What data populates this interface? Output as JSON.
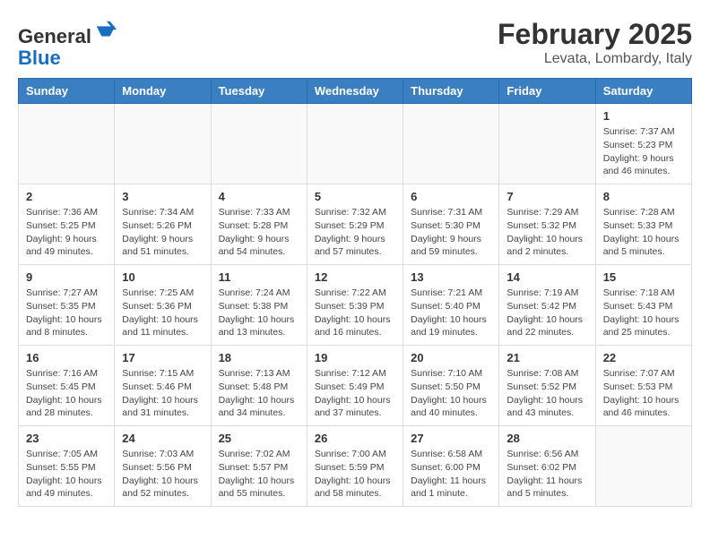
{
  "header": {
    "logo_general": "General",
    "logo_blue": "Blue",
    "month_year": "February 2025",
    "location": "Levata, Lombardy, Italy"
  },
  "weekdays": [
    "Sunday",
    "Monday",
    "Tuesday",
    "Wednesday",
    "Thursday",
    "Friday",
    "Saturday"
  ],
  "weeks": [
    [
      {
        "day": "",
        "info": ""
      },
      {
        "day": "",
        "info": ""
      },
      {
        "day": "",
        "info": ""
      },
      {
        "day": "",
        "info": ""
      },
      {
        "day": "",
        "info": ""
      },
      {
        "day": "",
        "info": ""
      },
      {
        "day": "1",
        "info": "Sunrise: 7:37 AM\nSunset: 5:23 PM\nDaylight: 9 hours and 46 minutes."
      }
    ],
    [
      {
        "day": "2",
        "info": "Sunrise: 7:36 AM\nSunset: 5:25 PM\nDaylight: 9 hours and 49 minutes."
      },
      {
        "day": "3",
        "info": "Sunrise: 7:34 AM\nSunset: 5:26 PM\nDaylight: 9 hours and 51 minutes."
      },
      {
        "day": "4",
        "info": "Sunrise: 7:33 AM\nSunset: 5:28 PM\nDaylight: 9 hours and 54 minutes."
      },
      {
        "day": "5",
        "info": "Sunrise: 7:32 AM\nSunset: 5:29 PM\nDaylight: 9 hours and 57 minutes."
      },
      {
        "day": "6",
        "info": "Sunrise: 7:31 AM\nSunset: 5:30 PM\nDaylight: 9 hours and 59 minutes."
      },
      {
        "day": "7",
        "info": "Sunrise: 7:29 AM\nSunset: 5:32 PM\nDaylight: 10 hours and 2 minutes."
      },
      {
        "day": "8",
        "info": "Sunrise: 7:28 AM\nSunset: 5:33 PM\nDaylight: 10 hours and 5 minutes."
      }
    ],
    [
      {
        "day": "9",
        "info": "Sunrise: 7:27 AM\nSunset: 5:35 PM\nDaylight: 10 hours and 8 minutes."
      },
      {
        "day": "10",
        "info": "Sunrise: 7:25 AM\nSunset: 5:36 PM\nDaylight: 10 hours and 11 minutes."
      },
      {
        "day": "11",
        "info": "Sunrise: 7:24 AM\nSunset: 5:38 PM\nDaylight: 10 hours and 13 minutes."
      },
      {
        "day": "12",
        "info": "Sunrise: 7:22 AM\nSunset: 5:39 PM\nDaylight: 10 hours and 16 minutes."
      },
      {
        "day": "13",
        "info": "Sunrise: 7:21 AM\nSunset: 5:40 PM\nDaylight: 10 hours and 19 minutes."
      },
      {
        "day": "14",
        "info": "Sunrise: 7:19 AM\nSunset: 5:42 PM\nDaylight: 10 hours and 22 minutes."
      },
      {
        "day": "15",
        "info": "Sunrise: 7:18 AM\nSunset: 5:43 PM\nDaylight: 10 hours and 25 minutes."
      }
    ],
    [
      {
        "day": "16",
        "info": "Sunrise: 7:16 AM\nSunset: 5:45 PM\nDaylight: 10 hours and 28 minutes."
      },
      {
        "day": "17",
        "info": "Sunrise: 7:15 AM\nSunset: 5:46 PM\nDaylight: 10 hours and 31 minutes."
      },
      {
        "day": "18",
        "info": "Sunrise: 7:13 AM\nSunset: 5:48 PM\nDaylight: 10 hours and 34 minutes."
      },
      {
        "day": "19",
        "info": "Sunrise: 7:12 AM\nSunset: 5:49 PM\nDaylight: 10 hours and 37 minutes."
      },
      {
        "day": "20",
        "info": "Sunrise: 7:10 AM\nSunset: 5:50 PM\nDaylight: 10 hours and 40 minutes."
      },
      {
        "day": "21",
        "info": "Sunrise: 7:08 AM\nSunset: 5:52 PM\nDaylight: 10 hours and 43 minutes."
      },
      {
        "day": "22",
        "info": "Sunrise: 7:07 AM\nSunset: 5:53 PM\nDaylight: 10 hours and 46 minutes."
      }
    ],
    [
      {
        "day": "23",
        "info": "Sunrise: 7:05 AM\nSunset: 5:55 PM\nDaylight: 10 hours and 49 minutes."
      },
      {
        "day": "24",
        "info": "Sunrise: 7:03 AM\nSunset: 5:56 PM\nDaylight: 10 hours and 52 minutes."
      },
      {
        "day": "25",
        "info": "Sunrise: 7:02 AM\nSunset: 5:57 PM\nDaylight: 10 hours and 55 minutes."
      },
      {
        "day": "26",
        "info": "Sunrise: 7:00 AM\nSunset: 5:59 PM\nDaylight: 10 hours and 58 minutes."
      },
      {
        "day": "27",
        "info": "Sunrise: 6:58 AM\nSunset: 6:00 PM\nDaylight: 11 hours and 1 minute."
      },
      {
        "day": "28",
        "info": "Sunrise: 6:56 AM\nSunset: 6:02 PM\nDaylight: 11 hours and 5 minutes."
      },
      {
        "day": "",
        "info": ""
      }
    ]
  ]
}
